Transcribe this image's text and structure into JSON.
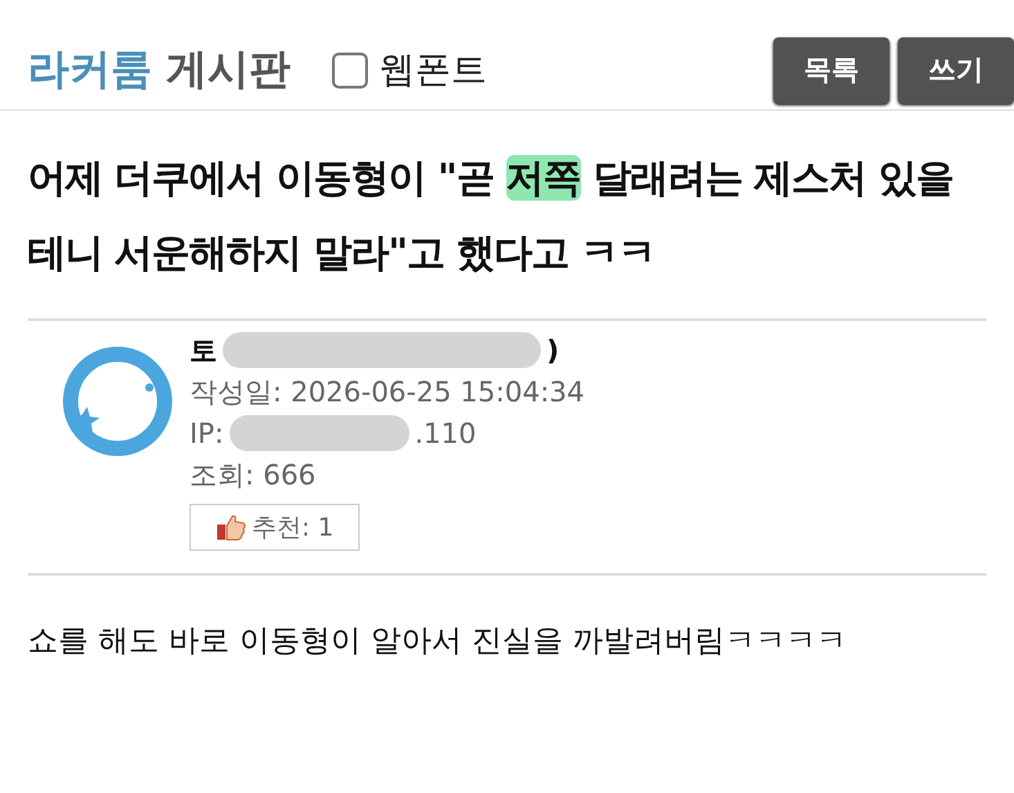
{
  "header": {
    "site": "라커룸",
    "board": "게시판",
    "webfont": {
      "label": "웹폰트",
      "checked": false
    },
    "buttons": [
      "목록",
      "쓰기"
    ]
  },
  "post": {
    "title": [
      {
        "text": "어제 더쿠에서 이동형이 \"곧 ",
        "highlighted": false
      },
      {
        "text": "저쪽",
        "highlighted": true
      },
      {
        "text": " 달래려는 제스처 있을테니 서운해하지 말라\"고 했다고 ㅋㅋ",
        "highlighted": false
      }
    ],
    "author": {
      "name_visible": "토",
      "name_end": ")",
      "redacted": true
    },
    "date": "작성일: 2026-06-25 15:04:34",
    "ip": {
      "prefix": "IP:",
      "suffix": ".110",
      "redacted": true
    },
    "views": "조회: 666",
    "recommend": "추천: 1",
    "body": "쇼를 해도 바로 이동형이 알아서 진실을 까발려버림ㅋㅋㅋㅋ"
  }
}
